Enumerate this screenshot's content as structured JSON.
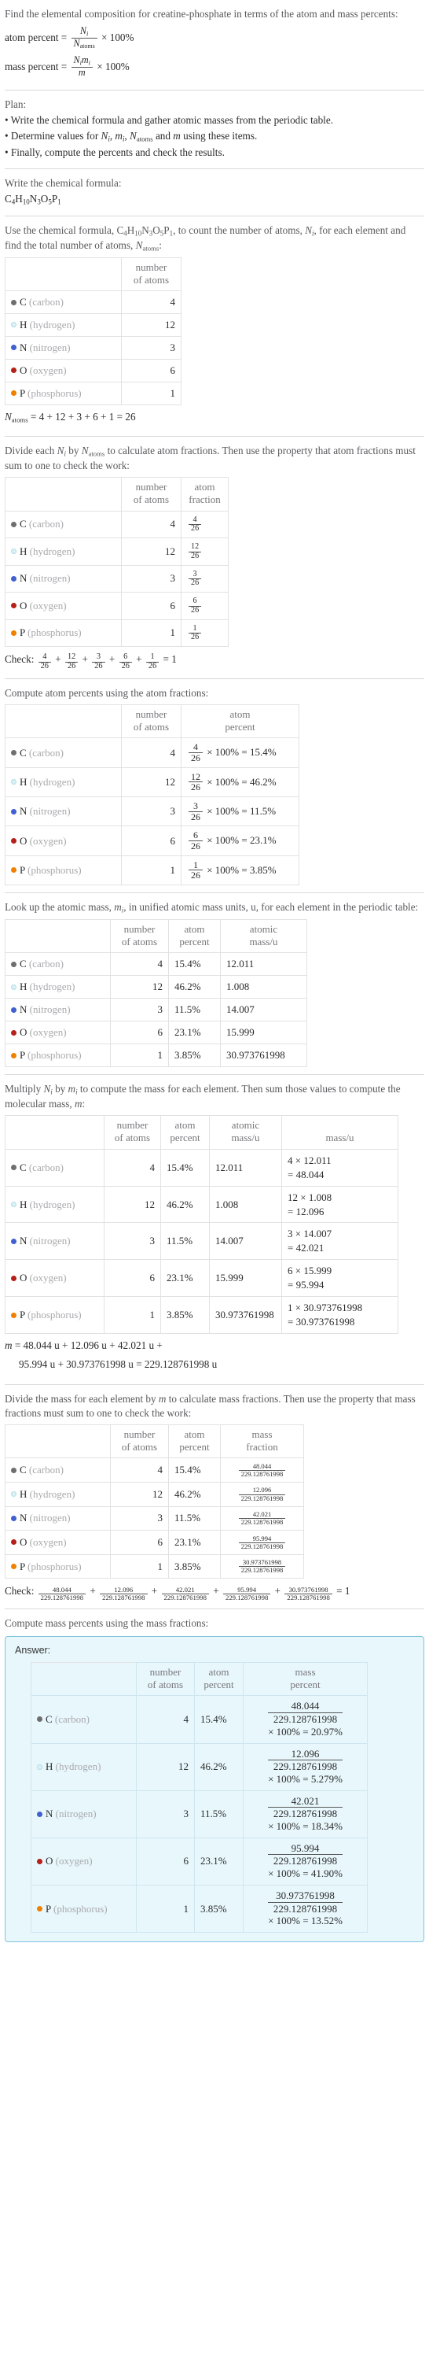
{
  "intro": {
    "question": "Find the elemental composition for creatine-phosphate in terms of the atom and mass percents:",
    "atom_percent_label": "atom percent =",
    "mass_percent_label": "mass percent =",
    "atom_percent_num": "N_i",
    "atom_percent_den": "N_atoms",
    "mass_percent_num": "N_i m_i",
    "mass_percent_den": "m",
    "times_100": "× 100%"
  },
  "plan": {
    "heading": "Plan:",
    "bullets": [
      "Write the chemical formula and gather atomic masses from the periodic table.",
      "Determine values for N_i, m_i, N_atoms and m using these items.",
      "Finally, compute the percents and check the results."
    ]
  },
  "formula_section": {
    "lead": "Write the chemical formula:",
    "formula": "C4H10N3O5P1"
  },
  "count_section": {
    "lead": "Use the chemical formula, C4H10N3O5P1, to count the number of atoms, N_i, for each element and find the total number of atoms, N_atoms:",
    "headers": [
      "",
      "number of atoms"
    ],
    "total_line": "N_atoms = 4 + 12 + 3 + 6 + 1 = 26"
  },
  "fraction_section": {
    "lead": "Divide each N_i by N_atoms to calculate atom fractions. Then use the property that atom fractions must sum to one to check the work:",
    "headers": [
      "",
      "number of atoms",
      "atom fraction"
    ],
    "check_label": "Check:",
    "check_result": "1"
  },
  "atom_percent_section": {
    "lead": "Compute atom percents using the atom fractions:",
    "headers": [
      "",
      "number of atoms",
      "atom percent"
    ]
  },
  "atomic_mass_section": {
    "lead": "Look up the atomic mass, m_i, in unified atomic mass units, u, for each element in the periodic table:",
    "headers": [
      "",
      "number of atoms",
      "atom percent",
      "atomic mass/u"
    ]
  },
  "mass_section": {
    "lead": "Multiply N_i by m_i to compute the mass for each element. Then sum those values to compute the molecular mass, m:",
    "headers": [
      "",
      "number of atoms",
      "atom percent",
      "atomic mass/u",
      "mass/u"
    ],
    "molecular_mass_line1": "m = 48.044 u + 12.096 u + 42.021 u +",
    "molecular_mass_line2": "95.994 u + 30.973761998 u = 229.128761998 u"
  },
  "mass_fraction_section": {
    "lead": "Divide the mass for each element by m to calculate mass fractions. Then use the property that mass fractions must sum to one to check the work:",
    "headers": [
      "",
      "number of atoms",
      "atom percent",
      "mass fraction"
    ],
    "check_label": "Check:",
    "check_result": "1"
  },
  "mass_percent_section": {
    "lead": "Compute mass percents using the mass fractions:",
    "answer_label": "Answer:",
    "headers": [
      "",
      "number of atoms",
      "atom percent",
      "mass percent"
    ]
  },
  "totals": {
    "n_atoms": "26",
    "molecular_mass": "229.128761998"
  },
  "colors": {
    "carbon": "#6e6e6e",
    "hydrogen": "#d9f2f7",
    "hydrogen_border": "#b6dce6",
    "nitrogen": "#4060d0",
    "oxygen": "#b52018",
    "phosphorus": "#f08000",
    "answer_bg": "#e8f7fc",
    "answer_border": "#7fc3dd",
    "rule": "#d8d8d8"
  },
  "elements": [
    {
      "symbol": "C",
      "name": "(carbon)",
      "dot": "carbon-dot",
      "count": "4",
      "atom_fraction_num": "4",
      "atom_fraction_den": "26",
      "atom_percent": "15.4%",
      "atomic_mass": "12.011",
      "mass_expr_a": "4 × 12.011",
      "mass_expr_b": "= 48.044",
      "mass": "48.044",
      "mass_percent": "20.97%"
    },
    {
      "symbol": "H",
      "name": "(hydrogen)",
      "dot": "hydrogen-dot",
      "count": "12",
      "atom_fraction_num": "12",
      "atom_fraction_den": "26",
      "atom_percent": "46.2%",
      "atomic_mass": "1.008",
      "mass_expr_a": "12 × 1.008",
      "mass_expr_b": "= 12.096",
      "mass": "12.096",
      "mass_percent": "5.279%"
    },
    {
      "symbol": "N",
      "name": "(nitrogen)",
      "dot": "nitrogen-dot",
      "count": "3",
      "atom_fraction_num": "3",
      "atom_fraction_den": "26",
      "atom_percent": "11.5%",
      "atomic_mass": "14.007",
      "mass_expr_a": "3 × 14.007",
      "mass_expr_b": "= 42.021",
      "mass": "42.021",
      "mass_percent": "18.34%"
    },
    {
      "symbol": "O",
      "name": "(oxygen)",
      "dot": "oxygen-dot",
      "count": "6",
      "atom_fraction_num": "6",
      "atom_fraction_den": "26",
      "atom_percent": "23.1%",
      "atomic_mass": "15.999",
      "mass_expr_a": "6 × 15.999",
      "mass_expr_b": "= 95.994",
      "mass": "95.994",
      "mass_percent": "41.90%"
    },
    {
      "symbol": "P",
      "name": "(phosphorus)",
      "dot": "phosphorus-dot",
      "count": "1",
      "atom_fraction_num": "1",
      "atom_fraction_den": "26",
      "atom_percent": "3.85%",
      "atomic_mass": "30.973761998",
      "mass_expr_a": "1 × 30.973761998",
      "mass_expr_b": "= 30.973761998",
      "mass": "30.973761998",
      "mass_percent": "13.52%"
    }
  ],
  "labels": {
    "times_100_percent": "× 100%",
    "equals": "=",
    "plus": "+",
    "col_blank": "",
    "col_number_of_atoms_1": "number",
    "col_number_of_atoms_2": "of atoms",
    "col_atom_1": "atom",
    "col_fraction_2": "fraction",
    "col_percent_2": "percent",
    "col_atomic_1": "atomic",
    "col_massu_2": "mass/u",
    "col_mass_1": "mass",
    "col_massu": "mass/u"
  }
}
